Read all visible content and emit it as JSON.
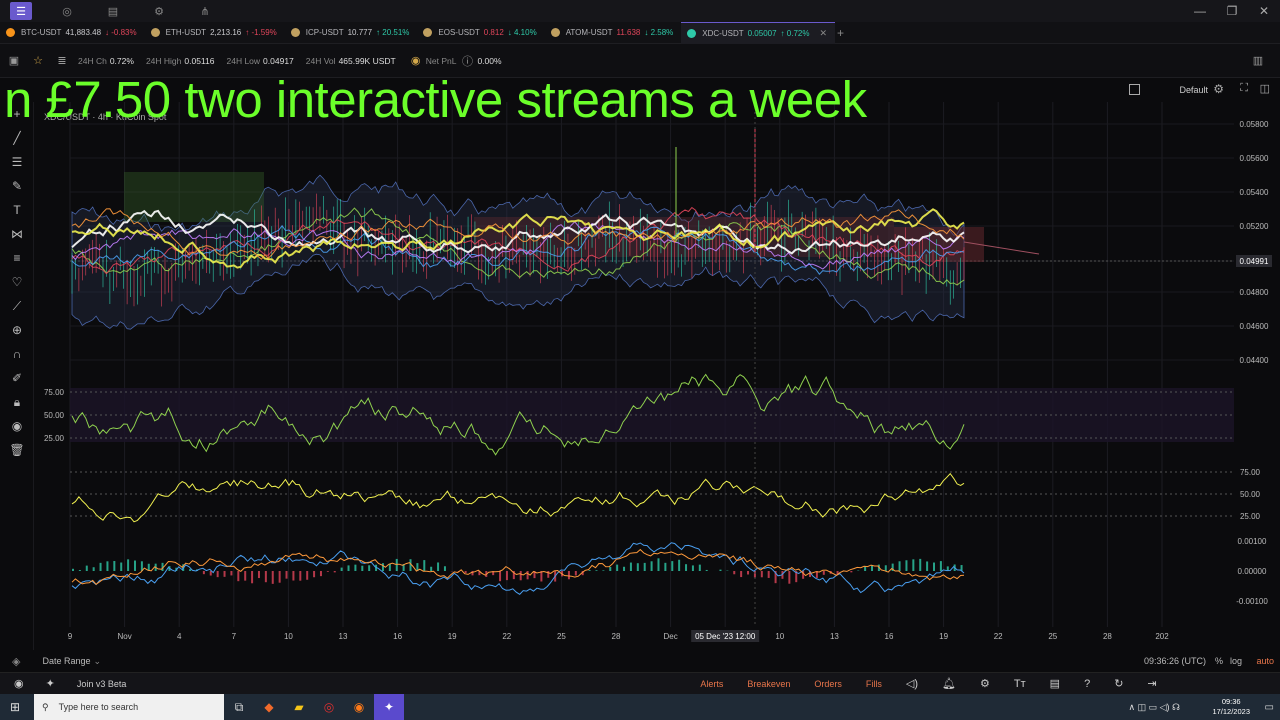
{
  "window": {
    "minimize": "—",
    "restore": "❐",
    "close": "✕"
  },
  "tickers": [
    {
      "symbol": "BTC-USDT",
      "price": "41,883.48",
      "change": "↓ -0.83%",
      "dir": "down",
      "color": "#f7931a"
    },
    {
      "symbol": "ETH-USDT",
      "price": "2,213.16",
      "change": "↑ -1.59%",
      "dir": "down",
      "color": "#c0a060"
    },
    {
      "symbol": "ICP-USDT",
      "price": "10.777",
      "change": "↑ 20.51%",
      "dir": "up",
      "color": "#c0a060"
    },
    {
      "symbol": "EOS-USDT",
      "price": "0.812",
      "change": "↓ 4.10%",
      "dir": "up",
      "color": "#c0a060"
    },
    {
      "symbol": "ATOM-USDT",
      "price": "11.638",
      "change": "↓ 2.58%",
      "dir": "up",
      "color": "#c0a060"
    },
    {
      "symbol": "XDC-USDT",
      "price": "0.05007",
      "change": "↑ 0.72%",
      "dir": "up",
      "color": "#2ec9a8"
    }
  ],
  "info": {
    "ch_label": "24H Ch",
    "ch_val": "0.72%",
    "high_label": "24H High",
    "high_val": "0.05116",
    "low_label": "24H Low",
    "low_val": "0.04917",
    "vol_label": "24H Vol",
    "vol_val": "465.99K USDT",
    "pnl_label": "Net PnL",
    "pnl_val": "0.00%"
  },
  "layout_label": "Default",
  "overlay_title": "n £7.50 two interactive streams a week",
  "symbol_line": "XDC/USDT · 4h · KuCoin Spot",
  "chart_data": {
    "type": "line",
    "price_axis_ticks": [
      "0.05800",
      "0.05600",
      "0.05400",
      "0.05200",
      "0.04991",
      "0.04800",
      "0.04600",
      "0.04400"
    ],
    "current_price": "0.04991",
    "rsi_ticks": [
      "75.00",
      "50.00",
      "25.00"
    ],
    "stoch_ticks": [
      "75.00",
      "50.00",
      "25.00"
    ],
    "macd_ticks": [
      "0.00100",
      "0.00000",
      "-0.00100"
    ],
    "x_ticks": [
      "9",
      "Nov",
      "4",
      "7",
      "10",
      "13",
      "16",
      "19",
      "22",
      "25",
      "28",
      "Dec",
      "05 Dec '23  12:00",
      "10",
      "13",
      "16",
      "19",
      "22",
      "25",
      "28",
      "202"
    ],
    "crosshair_time": "05 Dec '23  12:00"
  },
  "bottom": {
    "date_range": "Date Range",
    "time": "09:36:26 (UTC)",
    "pct": "%",
    "log": "log",
    "auto": "auto"
  },
  "footer": {
    "join": "Join v3 Beta",
    "alerts": "Alerts",
    "breakeven": "Breakeven",
    "orders": "Orders",
    "fills": "Fills"
  },
  "taskbar": {
    "search_placeholder": "Type here to search",
    "clock_time": "09:36",
    "clock_date": "17/12/2023"
  }
}
